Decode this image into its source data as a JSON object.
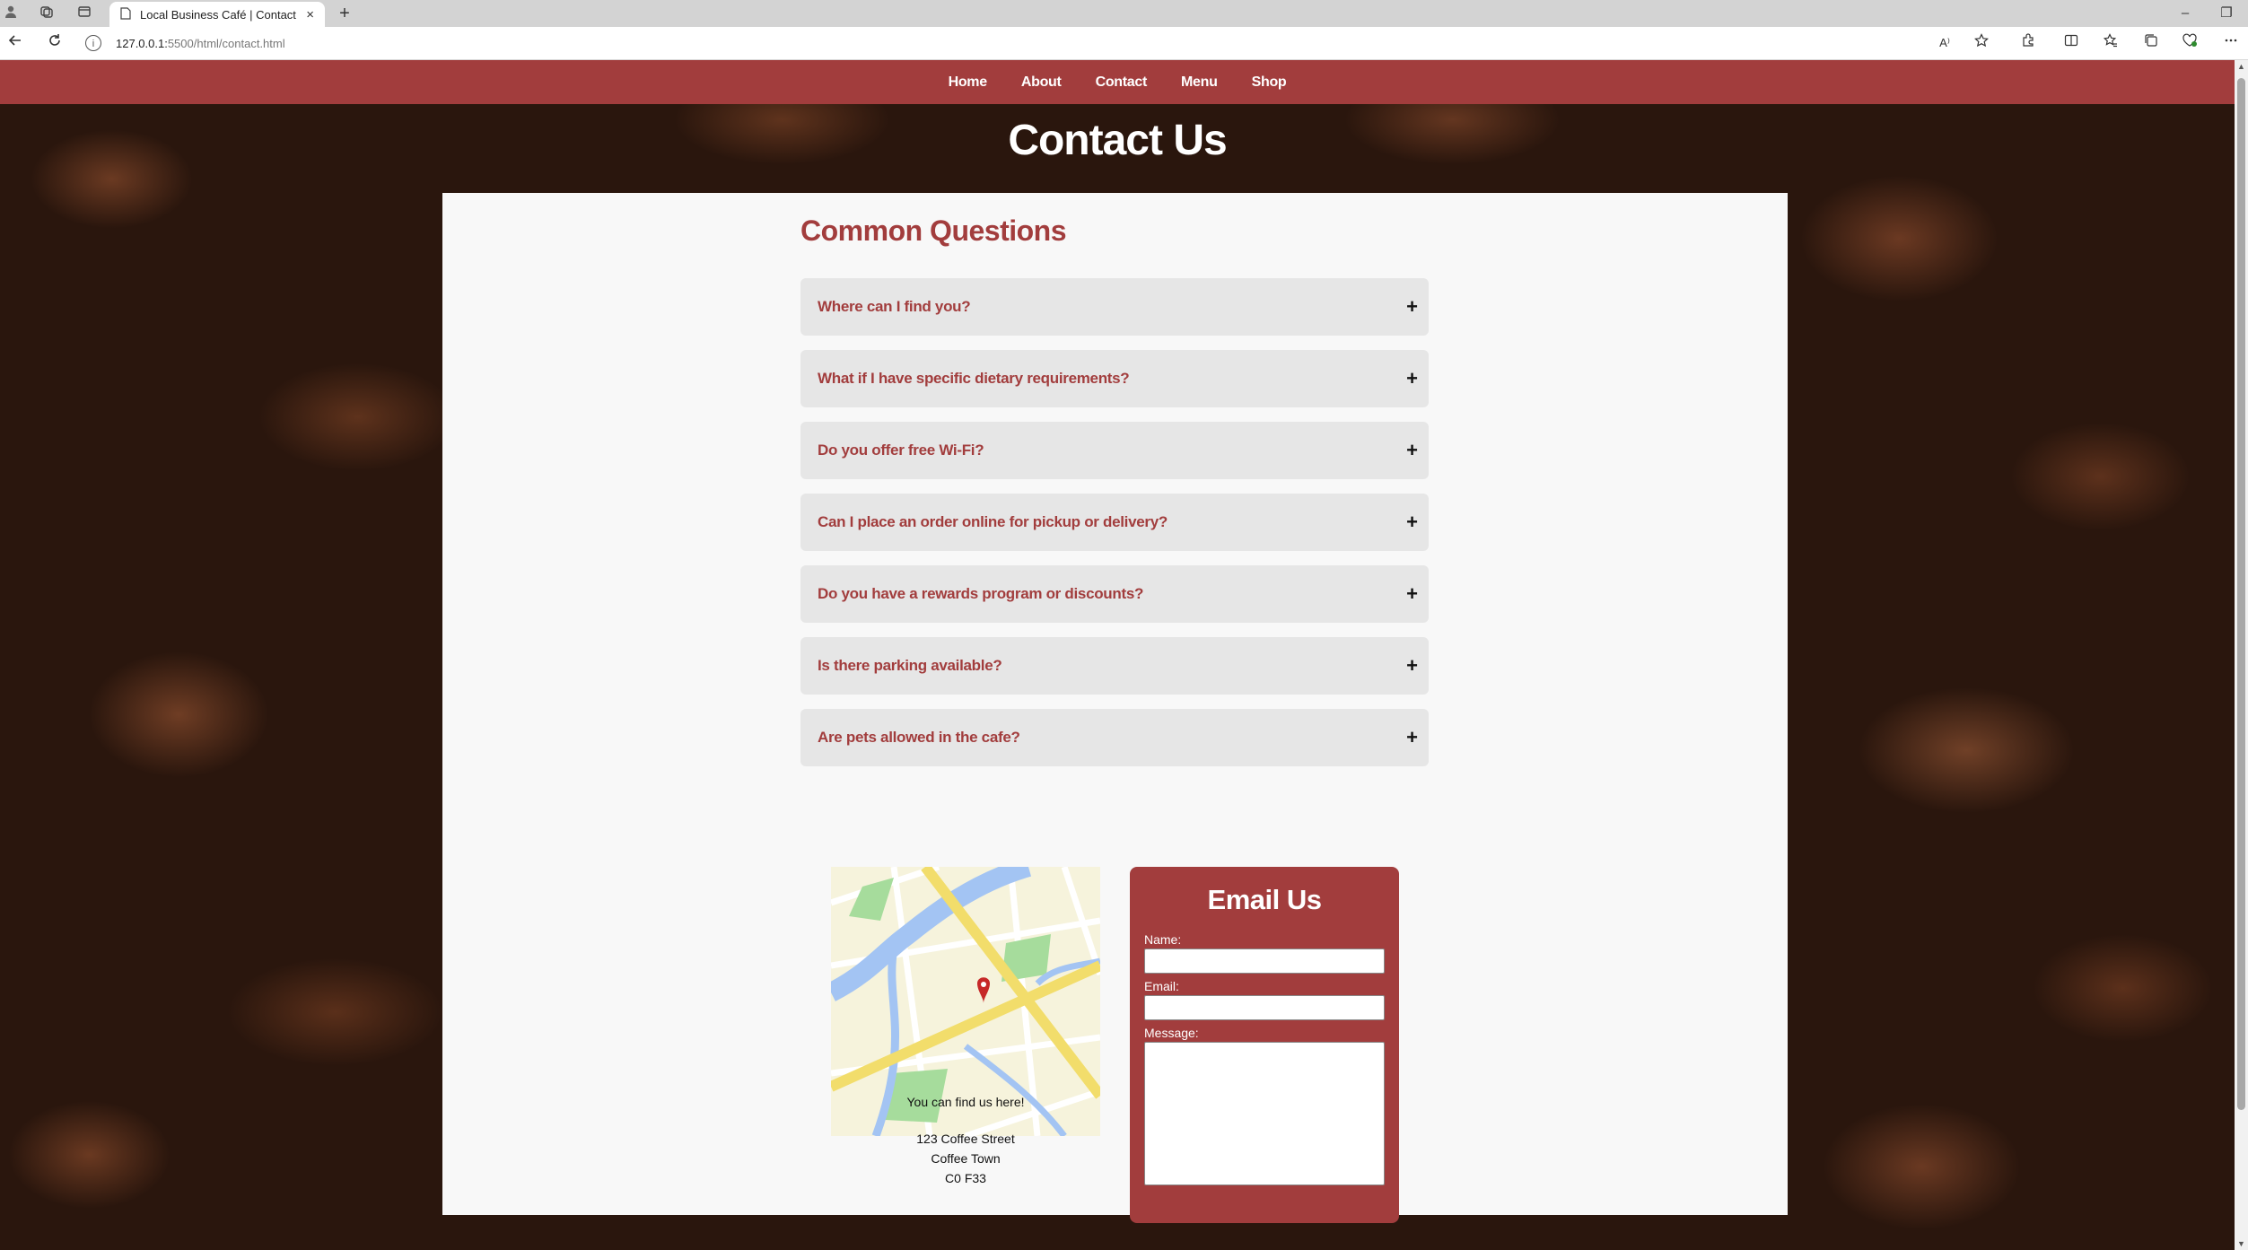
{
  "browser": {
    "tab_title": "Local Business Café | Contact",
    "tab_close": "×",
    "new_tab": "+",
    "url_host": "127.0.0.1:",
    "url_path": "5500/html/contact.html",
    "read_aloud": "A⁾",
    "window_min": "–",
    "window_restore": "❐"
  },
  "nav": {
    "items": [
      "Home",
      "About",
      "Contact",
      "Menu",
      "Shop"
    ]
  },
  "page": {
    "title": "Contact Us"
  },
  "faq": {
    "heading": "Common Questions",
    "expand_symbol": "+",
    "questions": [
      "Where can I find you?",
      "What if I have specific dietary requirements?",
      "Do you offer free Wi-Fi?",
      "Can I place an order online for pickup or delivery?",
      "Do you have a rewards program or discounts?",
      "Is there parking available?",
      "Are pets allowed in the cafe?"
    ]
  },
  "location": {
    "caption": "You can find us here!",
    "address_line1": "123 Coffee Street",
    "address_line2": "Coffee Town",
    "address_line3": "C0 F33"
  },
  "email_form": {
    "title": "Email Us",
    "name_label": "Name:",
    "email_label": "Email:",
    "message_label": "Message:",
    "name_value": "",
    "email_value": "",
    "message_value": ""
  },
  "colors": {
    "brand": "#a23d3d",
    "panel": "#f8f8f8",
    "faq_item": "#e6e6e6"
  },
  "icons": {
    "profile": "profile-icon",
    "workspaces": "workspaces-icon",
    "tab_actions": "tab-actions-icon",
    "page": "page-icon",
    "back": "back-arrow-icon",
    "refresh": "refresh-icon",
    "info": "info-icon",
    "favorite": "star-icon",
    "extensions": "extensions-icon",
    "split": "split-screen-icon",
    "favorites": "favorites-icon",
    "collections": "collections-icon",
    "browser_essentials": "browser-essentials-icon",
    "more": "more-icon",
    "map_pin": "map-pin-icon"
  }
}
